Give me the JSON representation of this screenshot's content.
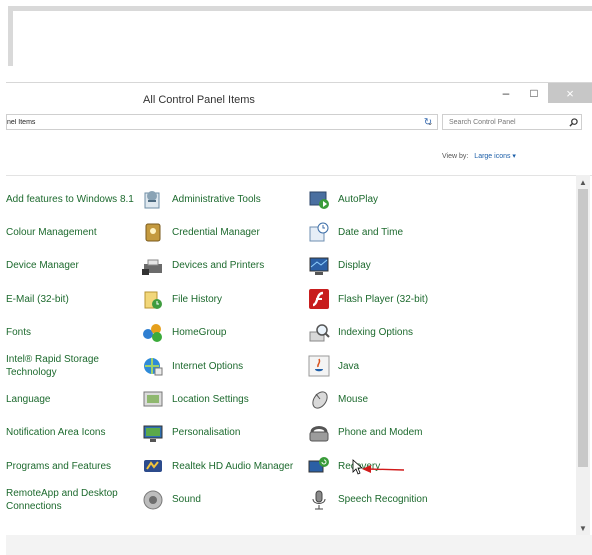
{
  "window": {
    "title": "All Control Panel Items",
    "controls": {
      "minimize": "–",
      "maximize": "□",
      "close": "×"
    }
  },
  "addressbar": {
    "path": "nel Items"
  },
  "search": {
    "placeholder": "Search Control Panel"
  },
  "viewby": {
    "label": "View by:",
    "value": "Large icons ▾"
  },
  "items": [
    {
      "label": "Add features to Windows 8.1",
      "icon": "add-features-icon",
      "col": 0,
      "row": 0,
      "shown": "Add features to Windows\n8.1"
    },
    {
      "label": "Administrative Tools",
      "icon": "admin-tools-icon",
      "col": 1,
      "row": 0
    },
    {
      "label": "AutoPlay",
      "icon": "autoplay-icon",
      "col": 2,
      "row": 0
    },
    {
      "label": "Colour Management",
      "icon": "colour-management-icon",
      "col": 0,
      "row": 1
    },
    {
      "label": "Credential Manager",
      "icon": "credential-manager-icon",
      "col": 1,
      "row": 1
    },
    {
      "label": "Date and Time",
      "icon": "date-time-icon",
      "col": 2,
      "row": 1
    },
    {
      "label": "Device Manager",
      "icon": "device-manager-icon",
      "col": 0,
      "row": 2
    },
    {
      "label": "Devices and Printers",
      "icon": "devices-printers-icon",
      "col": 1,
      "row": 2
    },
    {
      "label": "Display",
      "icon": "display-icon",
      "col": 2,
      "row": 2
    },
    {
      "label": "E-Mail (32-bit)",
      "icon": "email-icon",
      "col": 0,
      "row": 3
    },
    {
      "label": "File History",
      "icon": "file-history-icon",
      "col": 1,
      "row": 3
    },
    {
      "label": "Flash Player (32-bit)",
      "icon": "flash-player-icon",
      "col": 2,
      "row": 3
    },
    {
      "label": "Fonts",
      "icon": "fonts-icon",
      "col": 0,
      "row": 4
    },
    {
      "label": "HomeGroup",
      "icon": "homegroup-icon",
      "col": 1,
      "row": 4
    },
    {
      "label": "Indexing Options",
      "icon": "indexing-options-icon",
      "col": 2,
      "row": 4
    },
    {
      "label": "Intel® Rapid Storage Technology",
      "icon": "intel-storage-icon",
      "col": 0,
      "row": 5
    },
    {
      "label": "Internet Options",
      "icon": "internet-options-icon",
      "col": 1,
      "row": 5
    },
    {
      "label": "Java",
      "icon": "java-icon",
      "col": 2,
      "row": 5
    },
    {
      "label": "Language",
      "icon": "language-icon",
      "col": 0,
      "row": 6
    },
    {
      "label": "Location Settings",
      "icon": "location-settings-icon",
      "col": 1,
      "row": 6
    },
    {
      "label": "Mouse",
      "icon": "mouse-icon",
      "col": 2,
      "row": 6
    },
    {
      "label": "Notification Area Icons",
      "icon": "notification-area-icon",
      "col": 0,
      "row": 7
    },
    {
      "label": "Personalisation",
      "icon": "personalisation-icon",
      "col": 1,
      "row": 7
    },
    {
      "label": "Phone and Modem",
      "icon": "phone-modem-icon",
      "col": 2,
      "row": 7
    },
    {
      "label": "Programs and Features",
      "icon": "programs-features-icon",
      "col": 0,
      "row": 8
    },
    {
      "label": "Realtek HD Audio Manager",
      "icon": "realtek-audio-icon",
      "col": 1,
      "row": 8
    },
    {
      "label": "Recovery",
      "icon": "recovery-icon",
      "col": 2,
      "row": 8
    },
    {
      "label": "RemoteApp and Desktop Connections",
      "icon": "remoteapp-icon",
      "col": 0,
      "row": 9
    },
    {
      "label": "Sound",
      "icon": "sound-icon",
      "col": 1,
      "row": 9
    },
    {
      "label": "Speech Recognition",
      "icon": "speech-recognition-icon",
      "col": 2,
      "row": 9
    }
  ],
  "colors": {
    "link_green": "#1d6a2e",
    "accent_blue": "#1b5ea8",
    "arrow_red": "#d11a1a"
  }
}
